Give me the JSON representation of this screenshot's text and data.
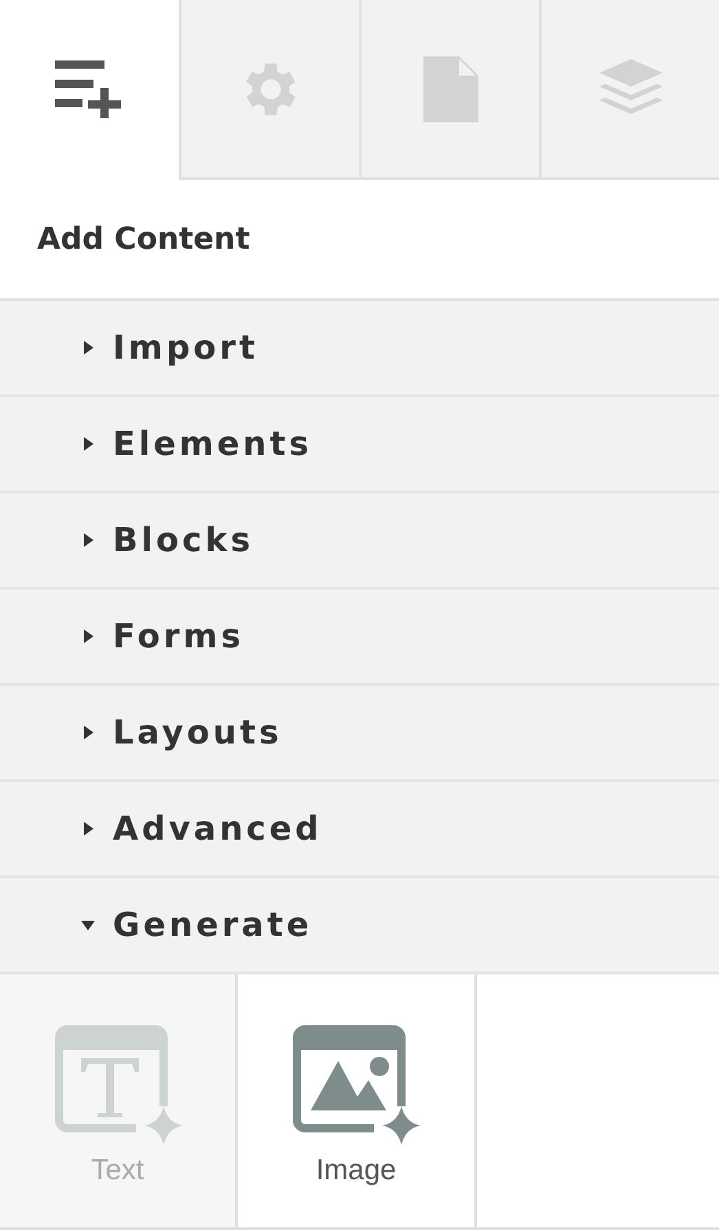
{
  "tabs": [
    {
      "kind": "add-content",
      "selected": true
    },
    {
      "kind": "settings",
      "selected": false
    },
    {
      "kind": "page",
      "selected": false
    },
    {
      "kind": "layers",
      "selected": false
    }
  ],
  "heading": "Add Content",
  "sections": [
    {
      "label": "Import",
      "expanded": false
    },
    {
      "label": "Elements",
      "expanded": false
    },
    {
      "label": "Blocks",
      "expanded": false
    },
    {
      "label": "Forms",
      "expanded": false
    },
    {
      "label": "Layouts",
      "expanded": false
    },
    {
      "label": "Advanced",
      "expanded": false
    },
    {
      "label": "Generate",
      "expanded": true
    }
  ],
  "tiles": [
    {
      "kind": "text",
      "label": "Text",
      "disabled": true
    },
    {
      "kind": "image",
      "label": "Image",
      "disabled": false
    }
  ]
}
